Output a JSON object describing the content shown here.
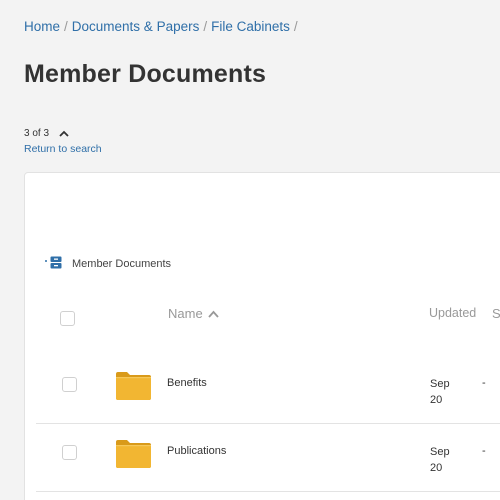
{
  "breadcrumb": {
    "items": [
      "Home",
      "Documents & Papers",
      "File Cabinets"
    ],
    "separator": "/"
  },
  "page_title": "Member Documents",
  "result_nav": {
    "position": "3 of 3",
    "return_link": "Return to search"
  },
  "folder_crumb": {
    "label": "Member Documents",
    "icon": "file-cabinet-icon"
  },
  "table": {
    "columns": {
      "name": "Name",
      "name_sort": "ascending",
      "updated": "Updated",
      "status_partial": "S"
    },
    "rows": [
      {
        "name": "Benefits",
        "updated": "Sep 20",
        "extra": "-",
        "icon": "folder-icon"
      },
      {
        "name": "Publications",
        "updated": "Sep 20",
        "extra": "-",
        "icon": "folder-icon"
      }
    ]
  },
  "colors": {
    "link": "#2f6fa8",
    "folder": "#f2b632",
    "folder_dark": "#d99a1a",
    "background": "#f3f3f3"
  }
}
